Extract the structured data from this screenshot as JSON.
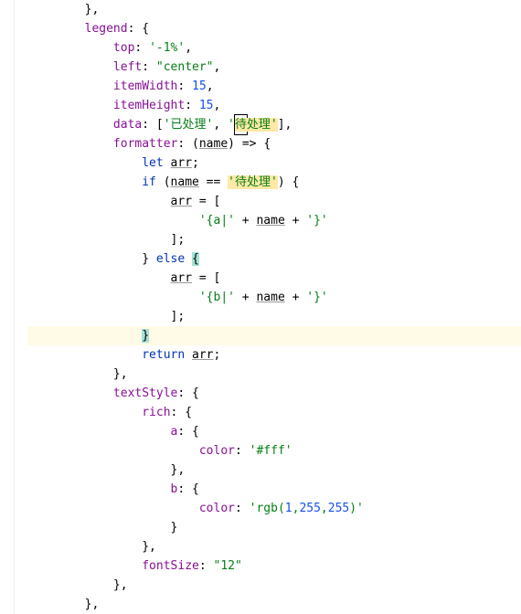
{
  "tokens": {
    "close_brace_comma": "},",
    "open_brace": "{",
    "close_brace": "}",
    "open_bracket": "[",
    "close_bracket": "]",
    "colon": ": ",
    "comma": ",",
    "semicolon": ";",
    "paren_open": "(",
    "paren_close": ")",
    "arrow": " => ",
    "assign": " = ",
    "eq": " == ",
    "plus": " + "
  },
  "props": {
    "legend": "legend",
    "top": "top",
    "left": "left",
    "itemWidth": "itemWidth",
    "itemHeight": "itemHeight",
    "data": "data",
    "formatter": "formatter",
    "textStyle": "textStyle",
    "rich": "rich",
    "a": "a",
    "b": "b",
    "color": "color",
    "fontSize": "fontSize"
  },
  "values": {
    "top": "'-1%'",
    "left": "\"center\"",
    "itemWidth": "15",
    "itemHeight": "15",
    "data0": "'已处理'",
    "data1_q": "'",
    "data1_char": "待",
    "data1_rest": "处理'",
    "name_param": "name",
    "arr_var": "arr",
    "cmp_str": "'待处理'",
    "str_a_open": "'{a|'",
    "str_b_open": "'{b|'",
    "str_close": "'}'",
    "color_a": "'#fff'",
    "rgb_prefix": "'rgb(",
    "rgb_1": "1",
    "rgb_2": "255",
    "rgb_3": "255",
    "rgb_suffix": ")'",
    "fontSize": "\"12\""
  },
  "keywords": {
    "let": "let",
    "if": "if",
    "else": "else",
    "return": "return"
  },
  "indent": {
    "i2": "        ",
    "i3": "            ",
    "i4": "                ",
    "i5": "                    ",
    "i6": "                        ",
    "i7": "                            ",
    "i8": "                                "
  }
}
